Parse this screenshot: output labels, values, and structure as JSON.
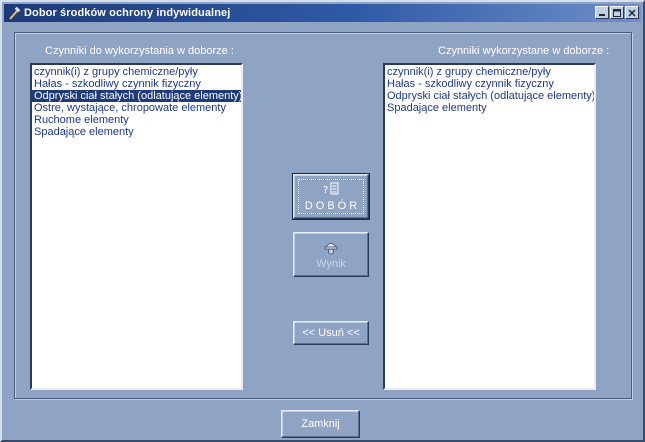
{
  "window": {
    "title": "Dobor środków ochrony indywidualnej"
  },
  "left_panel": {
    "label": "Czynniki do wykorzystania w doborze :",
    "items": [
      "czynnik(i) z grupy chemiczne/pyły",
      "Hałas - szkodliwy czynnik fizyczny",
      "Odpryski ciał stałych (odlatujące elementy)",
      "Ostre, wystające, chropowate elementy",
      "Ruchome elementy",
      "Spadające elementy"
    ],
    "selected_index": 2
  },
  "right_panel": {
    "label": "Czynniki wykorzystane w doborze :",
    "items": [
      "czynnik(i) z grupy chemiczne/pyły",
      "Hałas - szkodliwy czynnik fizyczny",
      "Odpryski ciał stałych (odlatujące elementy)",
      "Spadające elementy"
    ]
  },
  "buttons": {
    "dobor": "DOBÓR",
    "wynik": "Wynik",
    "usun": "<< Usuń <<",
    "zamknij": "Zamknij"
  },
  "icons": {
    "app": "hammer-icon",
    "dobor": "question-list-icon",
    "wynik": "worker-helmet-icon"
  },
  "colors": {
    "title_bar": "#1d3a78",
    "background": "#8fa3c4",
    "selection": "#1e3a78",
    "list_text": "#1e3a8a"
  }
}
